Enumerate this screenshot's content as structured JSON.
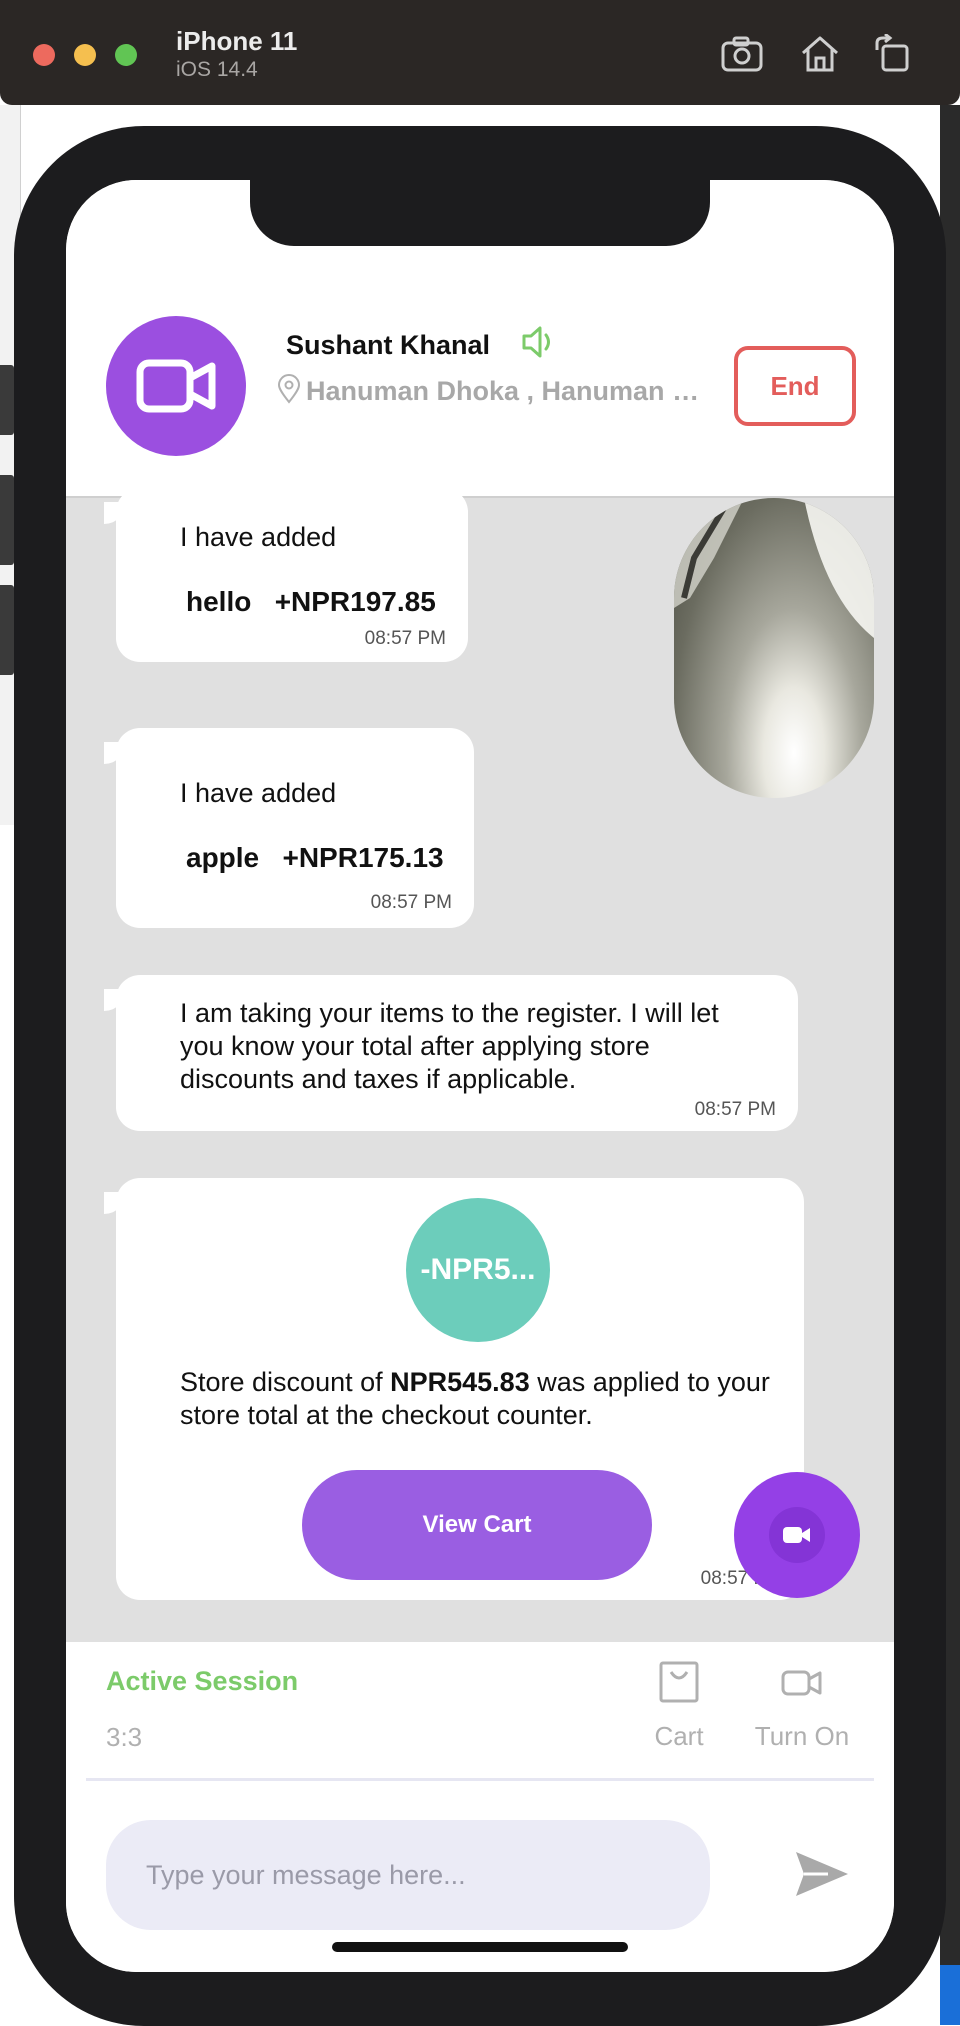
{
  "simulator": {
    "title": "iPhone 11",
    "subtitle": "iOS 14.4",
    "buttons": [
      "screenshot-icon",
      "home-icon",
      "rotate-icon"
    ]
  },
  "header": {
    "caller_name": "Sushant Khanal",
    "location": "Hanuman Dhoka , Hanuman Dhoka Durbar Square",
    "end_label": "End",
    "accent_color": "#9b4fe0",
    "end_color": "#e35d5b"
  },
  "messages": [
    {
      "type": "added",
      "label": "I have added",
      "item": "hello",
      "price": "+NPR197.85",
      "time": "08:57 PM"
    },
    {
      "type": "added",
      "label": "I have added",
      "item": "apple",
      "price": "+NPR175.13",
      "time": "08:57 PM"
    },
    {
      "type": "text",
      "text": "I am taking your items to the register. I will let you know your total after applying store discounts and taxes if applicable.",
      "time": "08:57 PM"
    },
    {
      "type": "discount",
      "badge": "-NPR5...",
      "text_prefix": "Store discount of ",
      "amount": "NPR545.83",
      "text_suffix": " was applied to your store total at the checkout counter.",
      "button_label": "View Cart",
      "time": "08:57 PM",
      "badge_color": "#6ccdbb"
    }
  ],
  "footer": {
    "session_label": "Active Session",
    "session_count": "3:3",
    "cart_label": "Cart",
    "camera_label": "Turn On",
    "input_placeholder": "Type your message here...",
    "session_color": "#7ccb6a"
  }
}
